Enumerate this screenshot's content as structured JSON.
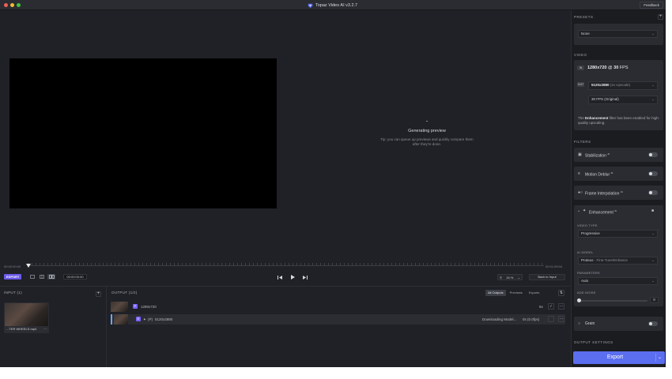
{
  "titlebar": {
    "title": "Topaz Video AI  v3.2.7",
    "feedback": "Feedback"
  },
  "preview": {
    "status": "Generating preview",
    "tip": "Tip: you can queue up previews and quickly compare them after they're done."
  },
  "timeline": {
    "start": "00:00:00:00",
    "end": "00:01:59:04",
    "export_badge": "EXPORT",
    "timecode": "00:00:00:00",
    "zoom": "16 %",
    "back_to_input": "Back to Input"
  },
  "input": {
    "title": "INPUT (1)",
    "file_name": "...TER WHEELS.mp4"
  },
  "output": {
    "title": "OUTPUT (1/2)",
    "tabs": [
      "All Outputs",
      "Previews",
      "Exports"
    ],
    "rows": [
      {
        "badge": "P",
        "label": "1280x720",
        "right": "5s"
      },
      {
        "badge": "E",
        "mode": "(P)",
        "label": "5120x2880",
        "status": "Downloading Model...",
        "right": "0s (0.0fps)"
      }
    ]
  },
  "sidebar": {
    "presets_title": "PRESETS",
    "preset_value": "None",
    "video_title": "VIDEO",
    "in_tag": "IN",
    "out_tag": "OUT",
    "in_res": "1280x720",
    "in_fps_sep": "@",
    "in_fps": "30",
    "in_fps_unit": "FPS",
    "out_res": "5120x2880",
    "out_res_note": "(4x Upscale)",
    "out_fps": "30 FPS (Original)",
    "note_pre": "The ",
    "note_bold": "Enhancement",
    "note_post": " filter has been enabled for high-quality upscaling.",
    "filters_title": "FILTERS",
    "filters": [
      {
        "label": "Stabilization",
        "sup": "AI"
      },
      {
        "label": "Motion Deblur",
        "sup": "AI"
      },
      {
        "label": "Frame Interpolation",
        "sup": "AI"
      }
    ],
    "enhancement": {
      "label": "Enhancement",
      "sup": "AI",
      "video_type_label": "VIDEO TYPE",
      "video_type": "Progressive",
      "ai_model_label": "AI MODEL",
      "ai_model": "Proteus",
      "ai_model_note": "- Fine-Tune/Enhance",
      "parameters_label": "PARAMETERS",
      "parameters": "Auto",
      "add_noise_label": "ADD NOISE",
      "add_noise_value": "0",
      "add_noise_level": 0
    },
    "grain_label": "Grain",
    "output_settings_title": "OUTPUT SETTINGS",
    "export_label": "Export"
  },
  "colors": {
    "accent": "#5b6ef0",
    "badge": "#7b61ff",
    "background": "#1f2126",
    "sidebar": "#1b1c20"
  }
}
